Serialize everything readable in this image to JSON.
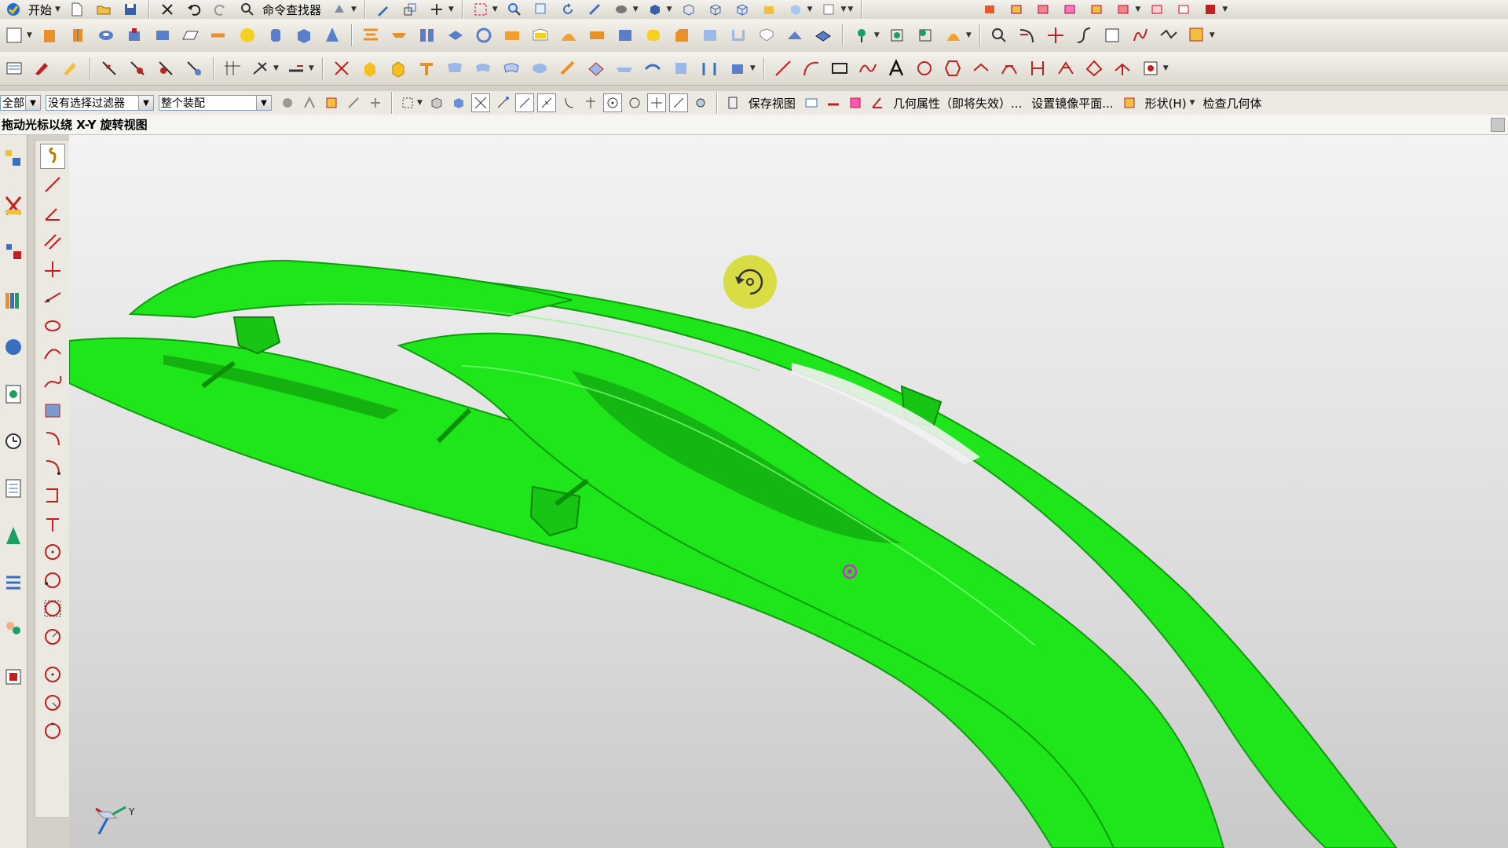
{
  "menubar": {
    "start_label": "开始",
    "command_finder_label": "命令查找器"
  },
  "selection": {
    "scope_value": "全部",
    "filter_value": "没有选择过滤器",
    "assembly_value": "整个装配",
    "save_view_label": "保存视图",
    "geometry_property_label": "几何属性（即将失效）...",
    "mirror_plane_label": "设置镜像平面...",
    "shape_label": "形状(H)",
    "check_geometry_label": "检查几何体"
  },
  "cue_line": {
    "text": "拖动光标以绕 X-Y 旋转视图"
  },
  "viewport": {
    "part_color": "#1fe51b",
    "part_edge_color": "#119c0e",
    "rotate_marker_color": "#d8dc3c",
    "pivot_marker_color": "#d02cc8",
    "triad_y_label": "Y"
  },
  "icons": {
    "toolbar_row1": [
      "new-file-icon",
      "open-folder-icon",
      "save-icon",
      "cut-icon",
      "undo-icon",
      "redo-icon",
      "command-finder-icon",
      "touch-mode-icon",
      "edit-object-icon",
      "ucs-icon",
      "snap-icon",
      "fit-icon",
      "zoom-icon",
      "zoom-window-icon",
      "rotate-icon",
      "pan-icon",
      "render-style-icon",
      "shaded-icon",
      "view-front-icon",
      "view-top-icon",
      "view-iso-icon",
      "wcs-icon",
      "show-hide-icon",
      "layer-icon",
      "reset-orient-icon",
      "feature-group-icon",
      "assembly-icon",
      "component-icon",
      "constraint-icon",
      "move-component-icon",
      "exploded-view-icon",
      "clearance-icon",
      "color-icon"
    ],
    "toolbar_row2": [
      "sketch-icon",
      "extrude-icon",
      "revolve-icon",
      "hole-icon",
      "boss-icon",
      "pad-icon",
      "pocket-icon",
      "slot-icon",
      "sphere-icon",
      "cylinder-icon",
      "block-icon",
      "cone-icon",
      "emboss-icon",
      "thicken-icon",
      "offset-face-icon",
      "mirror-icon",
      "pattern-icon",
      "unite-icon",
      "subtract-icon",
      "intersect-icon",
      "trim-body-icon",
      "split-body-icon",
      "blend-icon",
      "chamfer-icon",
      "draft-icon",
      "shell-icon",
      "scale-icon",
      "wrap-icon",
      "sew-icon",
      "patch-icon",
      "datum-plane-icon",
      "datum-axis-icon",
      "datum-csys-icon",
      "point-icon",
      "offset-surface-icon",
      "extract-icon",
      "project-curve-icon",
      "intersect-curve-icon",
      "bridge-curve-icon",
      "section-curve-icon",
      "isoparametric-icon",
      "curve-on-surface-icon",
      "analysis-icon"
    ],
    "toolbar_row3": [
      "wave-icon",
      "edit-feature-icon",
      "feature-replay-icon",
      "delete-feature-icon",
      "suppress-icon",
      "move-face-icon",
      "replace-face-icon",
      "dimension-icon",
      "measure-icon",
      "through-curves-icon",
      "face-blend-icon",
      "ruled-icon",
      "swept-icon",
      "sheet-icon",
      "n-sided-icon",
      "studio-surface-icon",
      "law-extension-icon",
      "quilt-icon",
      "trim-sheet-icon",
      "extend-sheet-icon",
      "bounded-plane-icon",
      "enlarge-icon",
      "offset-curve-icon",
      "mirror-curve-icon",
      "line-icon",
      "arc-icon",
      "rectangle-icon",
      "spline-icon",
      "text-icon",
      "helix-icon",
      "polygon-icon",
      "curve-analysis-icon",
      "face-analysis-icon",
      "deviation-icon",
      "draft-analysis-icon",
      "inspect-icon"
    ],
    "sketch_tools": [
      "view-rotate-icon",
      "line-tool-icon",
      "angle-line-icon",
      "parallel-line-icon",
      "perpendicular-line-icon",
      "tangent-line-icon",
      "arc-3pt-icon",
      "arc-tangent-icon",
      "arc-fit-icon",
      "rectangle-tool-icon",
      "fillet-tool-icon",
      "chamfer-tool-icon",
      "trim-tool-icon",
      "extend-tool-icon",
      "circle-center-icon",
      "circle-3pt-icon",
      "circle-tangent-icon",
      "circle-radius-icon",
      "point-circle-icon",
      "circle-edit-icon",
      "circle-offset-icon"
    ],
    "resource_bar": [
      "assembly-navigator-icon",
      "constraint-navigator-icon",
      "part-navigator-icon",
      "reuse-library-icon",
      "hd3d-icon",
      "web-browser-icon",
      "history-icon",
      "system-materials-icon",
      "process-studio-icon",
      "manufacturing-wizard-icon",
      "roles-icon",
      "system-scenes-icon"
    ]
  }
}
